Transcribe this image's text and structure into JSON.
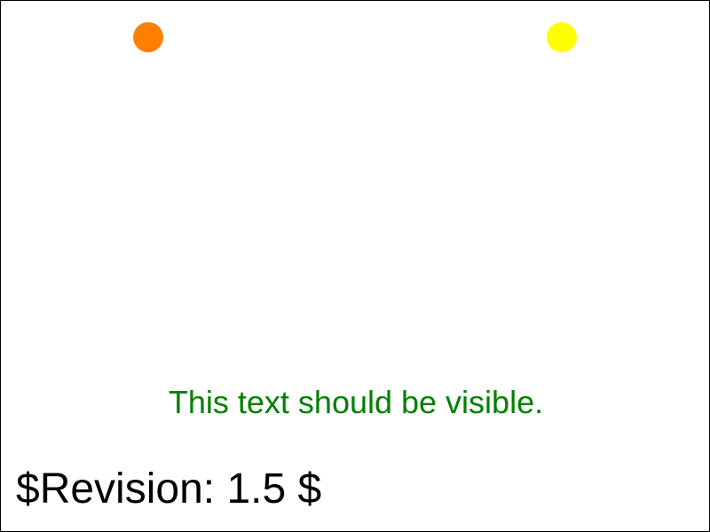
{
  "colors": {
    "orange_dot": "#ff7f00",
    "yellow_dot": "#ffff00",
    "visible_text": "#008000"
  },
  "main": {
    "visible_text": "This text should be visible."
  },
  "footer": {
    "revision": "$Revision: 1.5 $"
  }
}
